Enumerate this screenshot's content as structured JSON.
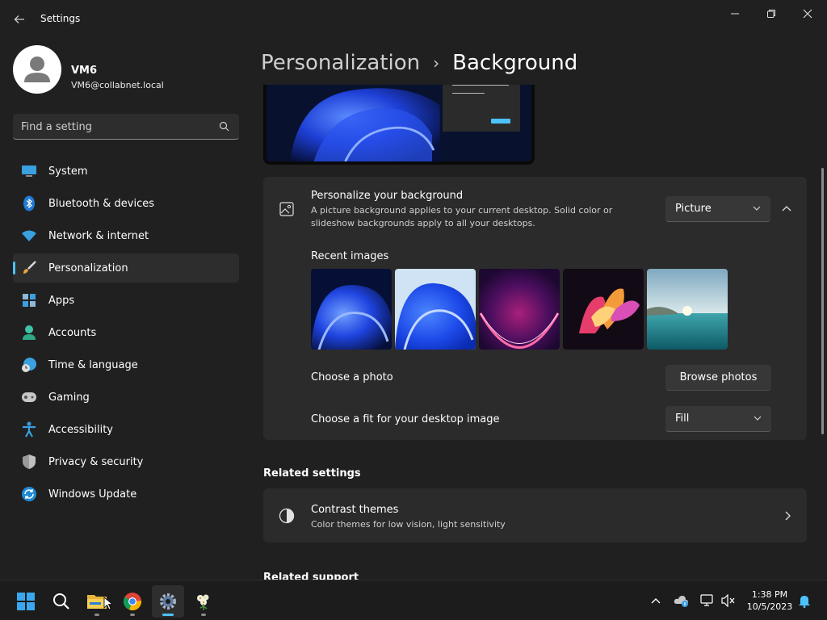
{
  "window": {
    "app_title": "Settings",
    "back_icon": "back-arrow-icon",
    "controls": [
      "minimize-icon",
      "restore-icon",
      "close-icon"
    ]
  },
  "user": {
    "name": "VM6",
    "email": "VM6@collabnet.local"
  },
  "search": {
    "placeholder": "Find a setting",
    "icon": "search-icon"
  },
  "nav": {
    "items": [
      {
        "label": "System",
        "icon": "system-icon"
      },
      {
        "label": "Bluetooth & devices",
        "icon": "bluetooth-icon"
      },
      {
        "label": "Network & internet",
        "icon": "wifi-icon"
      },
      {
        "label": "Personalization",
        "icon": "brush-icon",
        "active": true
      },
      {
        "label": "Apps",
        "icon": "apps-icon"
      },
      {
        "label": "Accounts",
        "icon": "accounts-icon"
      },
      {
        "label": "Time & language",
        "icon": "clock-globe-icon"
      },
      {
        "label": "Gaming",
        "icon": "gamepad-icon"
      },
      {
        "label": "Accessibility",
        "icon": "accessibility-icon"
      },
      {
        "label": "Privacy & security",
        "icon": "shield-icon"
      },
      {
        "label": "Windows Update",
        "icon": "update-icon"
      }
    ]
  },
  "breadcrumb": {
    "parent": "Personalization",
    "separator": "›",
    "current": "Background"
  },
  "background_card": {
    "title": "Personalize your background",
    "description_line1": "A picture background applies to your current desktop. Solid color or",
    "description_line2": "slideshow backgrounds apply to all your desktops.",
    "dropdown_value": "Picture",
    "recent_images_label": "Recent images",
    "choose_photo_label": "Choose a photo",
    "browse_button_label": "Browse photos",
    "choose_fit_label": "Choose a fit for your desktop image",
    "fit_value": "Fill"
  },
  "related_settings": {
    "heading": "Related settings",
    "contrast_title": "Contrast themes",
    "contrast_desc": "Color themes for low vision, light sensitivity"
  },
  "related_support": {
    "heading": "Related support"
  },
  "taskbar": {
    "apps": [
      "windows-start-icon",
      "search-icon",
      "file-explorer-icon",
      "chrome-icon",
      "settings-gear-icon",
      "photos-app-icon"
    ],
    "tray": [
      "chevron-up-icon",
      "onedrive-icon",
      "network-icon",
      "volume-muted-icon",
      "notification-bell-icon"
    ],
    "time": "1:38 PM",
    "date": "10/5/2023"
  },
  "colors": {
    "accent": "#4cc2ff",
    "background": "#202020",
    "card": "#2b2b2b"
  }
}
